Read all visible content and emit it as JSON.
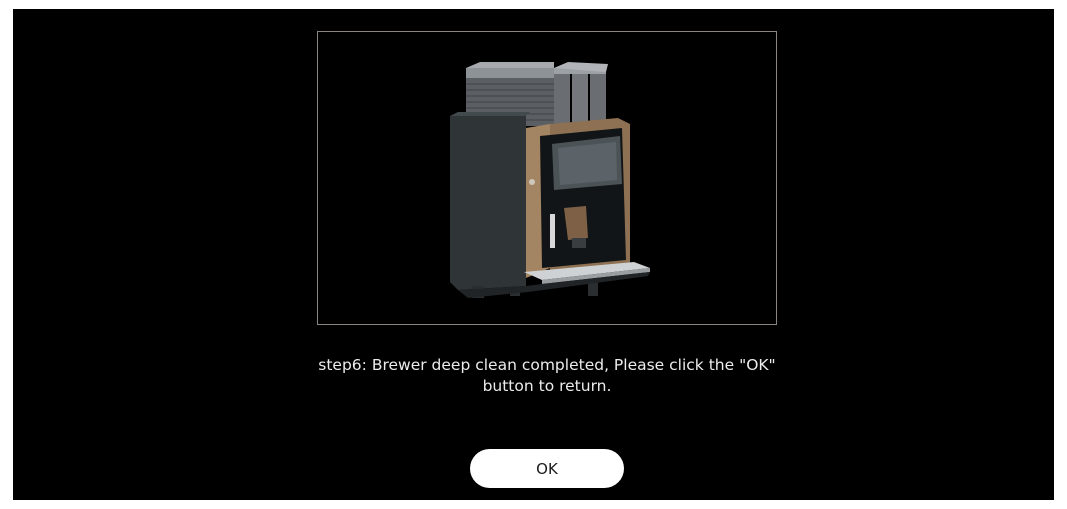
{
  "dialog": {
    "image_alt": "coffee-machine-illustration",
    "message": "step6: Brewer deep clean completed, Please click the \"OK\"\nbutton to return.",
    "ok_label": "OK"
  },
  "colors": {
    "background": "#000000",
    "frame_border": "#8a8580",
    "text": "#ececec",
    "button_bg": "#ffffff",
    "button_text": "#1a1a1a"
  }
}
